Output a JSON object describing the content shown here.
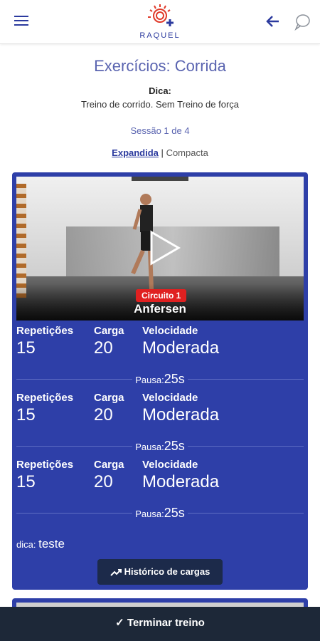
{
  "header": {
    "logo_text": "RAQUEL",
    "menu_icon": "hamburger-icon",
    "back_icon": "arrow-left-icon",
    "chat_icon": "chat-bubble-icon"
  },
  "page": {
    "title": "Exercícios: Corrida",
    "tip_label": "Dica:",
    "tip_text": "Treino de corrido. Sem Treino de força",
    "session": "Sessão 1 de 4",
    "view_expanded": "Expandida",
    "view_separator": "|",
    "view_compact": "Compacta"
  },
  "exercise": {
    "circuit": "Circuito 1",
    "name": "Anfersen",
    "labels": {
      "reps": "Repetições",
      "load": "Carga",
      "speed": "Velocidade"
    },
    "sets": [
      {
        "reps": "15",
        "load": "20",
        "speed": "Moderada",
        "pause_label": "Pausa:",
        "pause": "25s"
      },
      {
        "reps": "15",
        "load": "20",
        "speed": "Moderada",
        "pause_label": "Pausa:",
        "pause": "25s"
      },
      {
        "reps": "15",
        "load": "20",
        "speed": "Moderada",
        "pause_label": "Pausa:",
        "pause": "25s"
      }
    ],
    "tip_label": "dica:",
    "tip_value": "teste",
    "history_button": "Histórico de cargas"
  },
  "footer": {
    "finish_button": "✓ Terminar treino"
  },
  "colors": {
    "accent": "#2e3fa8",
    "title": "#5a64b0",
    "badge": "#e02020",
    "footer": "#1d2838"
  }
}
